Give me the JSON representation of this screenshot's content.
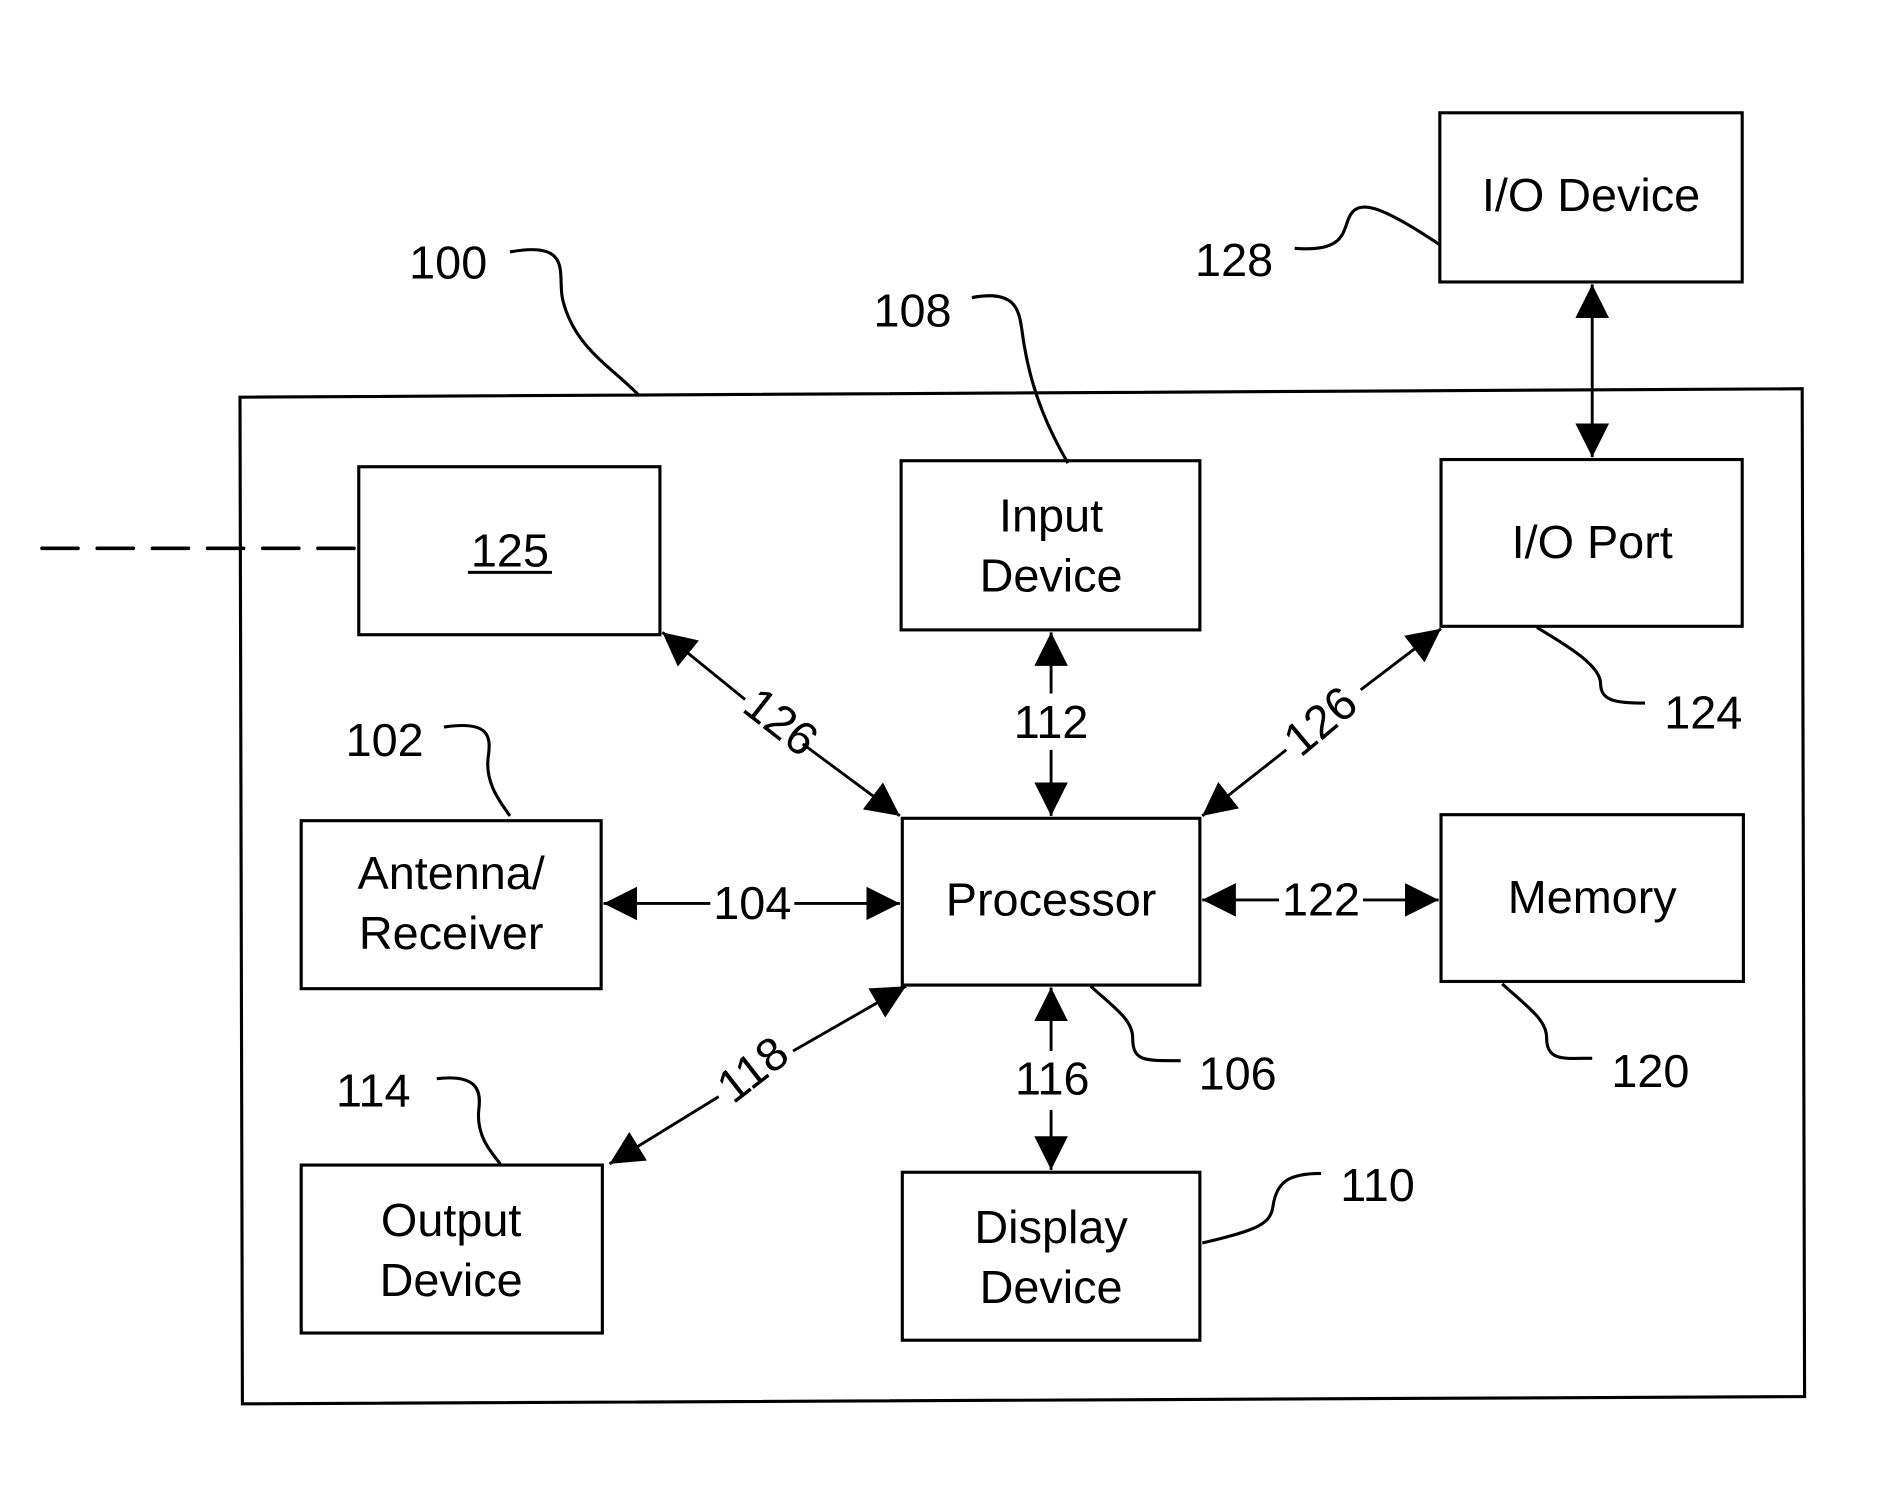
{
  "figure": {
    "device_ref": "100",
    "blocks": {
      "unit_125": {
        "label": "125",
        "underlined": true
      },
      "input_device": {
        "line1": "Input",
        "line2": "Device",
        "ref": "108"
      },
      "io_port": {
        "label": "I/O Port",
        "ref": "124"
      },
      "io_device": {
        "label": "I/O Device",
        "ref": "128"
      },
      "antenna_receiver": {
        "line1": "Antenna/",
        "line2": "Receiver",
        "ref": "102"
      },
      "processor": {
        "label": "Processor",
        "ref": "106"
      },
      "memory": {
        "label": "Memory",
        "ref": "120"
      },
      "output_device": {
        "line1": "Output",
        "line2": "Device",
        "ref": "114"
      },
      "display_device": {
        "line1": "Display",
        "line2": "Device",
        "ref": "110"
      }
    },
    "connections": {
      "unit125_processor": "126",
      "input_processor": "112",
      "ioport_processor": "126",
      "antenna_processor": "104",
      "processor_memory": "122",
      "output_processor": "118",
      "processor_display": "116"
    }
  }
}
